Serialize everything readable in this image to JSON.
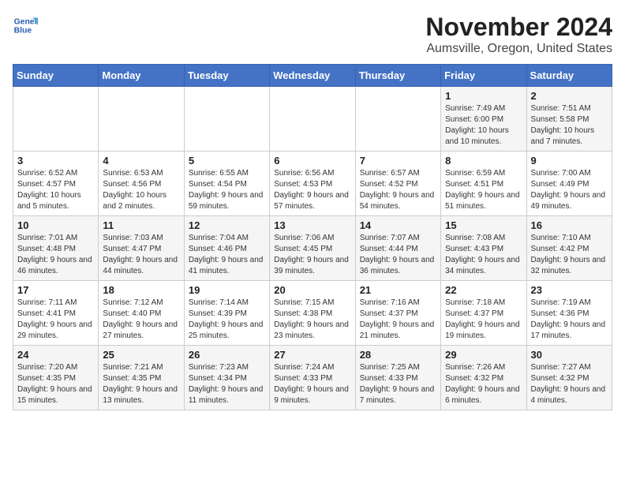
{
  "logo": {
    "line1": "General",
    "line2": "Blue"
  },
  "header": {
    "month": "November 2024",
    "location": "Aumsville, Oregon, United States"
  },
  "weekdays": [
    "Sunday",
    "Monday",
    "Tuesday",
    "Wednesday",
    "Thursday",
    "Friday",
    "Saturday"
  ],
  "weeks": [
    [
      {
        "day": "",
        "info": ""
      },
      {
        "day": "",
        "info": ""
      },
      {
        "day": "",
        "info": ""
      },
      {
        "day": "",
        "info": ""
      },
      {
        "day": "",
        "info": ""
      },
      {
        "day": "1",
        "info": "Sunrise: 7:49 AM\nSunset: 6:00 PM\nDaylight: 10 hours and 10 minutes."
      },
      {
        "day": "2",
        "info": "Sunrise: 7:51 AM\nSunset: 5:58 PM\nDaylight: 10 hours and 7 minutes."
      }
    ],
    [
      {
        "day": "3",
        "info": "Sunrise: 6:52 AM\nSunset: 4:57 PM\nDaylight: 10 hours and 5 minutes."
      },
      {
        "day": "4",
        "info": "Sunrise: 6:53 AM\nSunset: 4:56 PM\nDaylight: 10 hours and 2 minutes."
      },
      {
        "day": "5",
        "info": "Sunrise: 6:55 AM\nSunset: 4:54 PM\nDaylight: 9 hours and 59 minutes."
      },
      {
        "day": "6",
        "info": "Sunrise: 6:56 AM\nSunset: 4:53 PM\nDaylight: 9 hours and 57 minutes."
      },
      {
        "day": "7",
        "info": "Sunrise: 6:57 AM\nSunset: 4:52 PM\nDaylight: 9 hours and 54 minutes."
      },
      {
        "day": "8",
        "info": "Sunrise: 6:59 AM\nSunset: 4:51 PM\nDaylight: 9 hours and 51 minutes."
      },
      {
        "day": "9",
        "info": "Sunrise: 7:00 AM\nSunset: 4:49 PM\nDaylight: 9 hours and 49 minutes."
      }
    ],
    [
      {
        "day": "10",
        "info": "Sunrise: 7:01 AM\nSunset: 4:48 PM\nDaylight: 9 hours and 46 minutes."
      },
      {
        "day": "11",
        "info": "Sunrise: 7:03 AM\nSunset: 4:47 PM\nDaylight: 9 hours and 44 minutes."
      },
      {
        "day": "12",
        "info": "Sunrise: 7:04 AM\nSunset: 4:46 PM\nDaylight: 9 hours and 41 minutes."
      },
      {
        "day": "13",
        "info": "Sunrise: 7:06 AM\nSunset: 4:45 PM\nDaylight: 9 hours and 39 minutes."
      },
      {
        "day": "14",
        "info": "Sunrise: 7:07 AM\nSunset: 4:44 PM\nDaylight: 9 hours and 36 minutes."
      },
      {
        "day": "15",
        "info": "Sunrise: 7:08 AM\nSunset: 4:43 PM\nDaylight: 9 hours and 34 minutes."
      },
      {
        "day": "16",
        "info": "Sunrise: 7:10 AM\nSunset: 4:42 PM\nDaylight: 9 hours and 32 minutes."
      }
    ],
    [
      {
        "day": "17",
        "info": "Sunrise: 7:11 AM\nSunset: 4:41 PM\nDaylight: 9 hours and 29 minutes."
      },
      {
        "day": "18",
        "info": "Sunrise: 7:12 AM\nSunset: 4:40 PM\nDaylight: 9 hours and 27 minutes."
      },
      {
        "day": "19",
        "info": "Sunrise: 7:14 AM\nSunset: 4:39 PM\nDaylight: 9 hours and 25 minutes."
      },
      {
        "day": "20",
        "info": "Sunrise: 7:15 AM\nSunset: 4:38 PM\nDaylight: 9 hours and 23 minutes."
      },
      {
        "day": "21",
        "info": "Sunrise: 7:16 AM\nSunset: 4:37 PM\nDaylight: 9 hours and 21 minutes."
      },
      {
        "day": "22",
        "info": "Sunrise: 7:18 AM\nSunset: 4:37 PM\nDaylight: 9 hours and 19 minutes."
      },
      {
        "day": "23",
        "info": "Sunrise: 7:19 AM\nSunset: 4:36 PM\nDaylight: 9 hours and 17 minutes."
      }
    ],
    [
      {
        "day": "24",
        "info": "Sunrise: 7:20 AM\nSunset: 4:35 PM\nDaylight: 9 hours and 15 minutes."
      },
      {
        "day": "25",
        "info": "Sunrise: 7:21 AM\nSunset: 4:35 PM\nDaylight: 9 hours and 13 minutes."
      },
      {
        "day": "26",
        "info": "Sunrise: 7:23 AM\nSunset: 4:34 PM\nDaylight: 9 hours and 11 minutes."
      },
      {
        "day": "27",
        "info": "Sunrise: 7:24 AM\nSunset: 4:33 PM\nDaylight: 9 hours and 9 minutes."
      },
      {
        "day": "28",
        "info": "Sunrise: 7:25 AM\nSunset: 4:33 PM\nDaylight: 9 hours and 7 minutes."
      },
      {
        "day": "29",
        "info": "Sunrise: 7:26 AM\nSunset: 4:32 PM\nDaylight: 9 hours and 6 minutes."
      },
      {
        "day": "30",
        "info": "Sunrise: 7:27 AM\nSunset: 4:32 PM\nDaylight: 9 hours and 4 minutes."
      }
    ]
  ]
}
